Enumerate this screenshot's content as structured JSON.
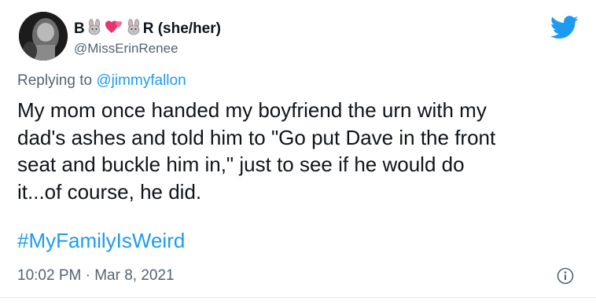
{
  "tweet": {
    "display_name_prefix": "B",
    "display_name_suffix": "R (she/her)",
    "handle": "@MissErinRenee",
    "replying_label": "Replying to ",
    "replying_to": "@jimmyfallon",
    "body_lines": [
      "My mom once handed my boyfriend the urn with my",
      "dad's ashes and told him to \"Go put Dave in the front",
      "seat and buckle him in,\" just to see if he would do",
      "it...of course, he did."
    ],
    "hashtag": "#MyFamilyIsWeird",
    "time": "10:02 PM",
    "separator": " · ",
    "date": "Mar 8, 2021"
  },
  "icons": {
    "logo": "twitter-bird-icon",
    "info": "info-icon",
    "name_emojis": [
      "rabbit-face-icon",
      "two-hearts-icon",
      "rabbit-face-icon"
    ]
  },
  "colors": {
    "accent": "#1d9bf0",
    "text": "#0f1419",
    "muted": "#536471"
  }
}
